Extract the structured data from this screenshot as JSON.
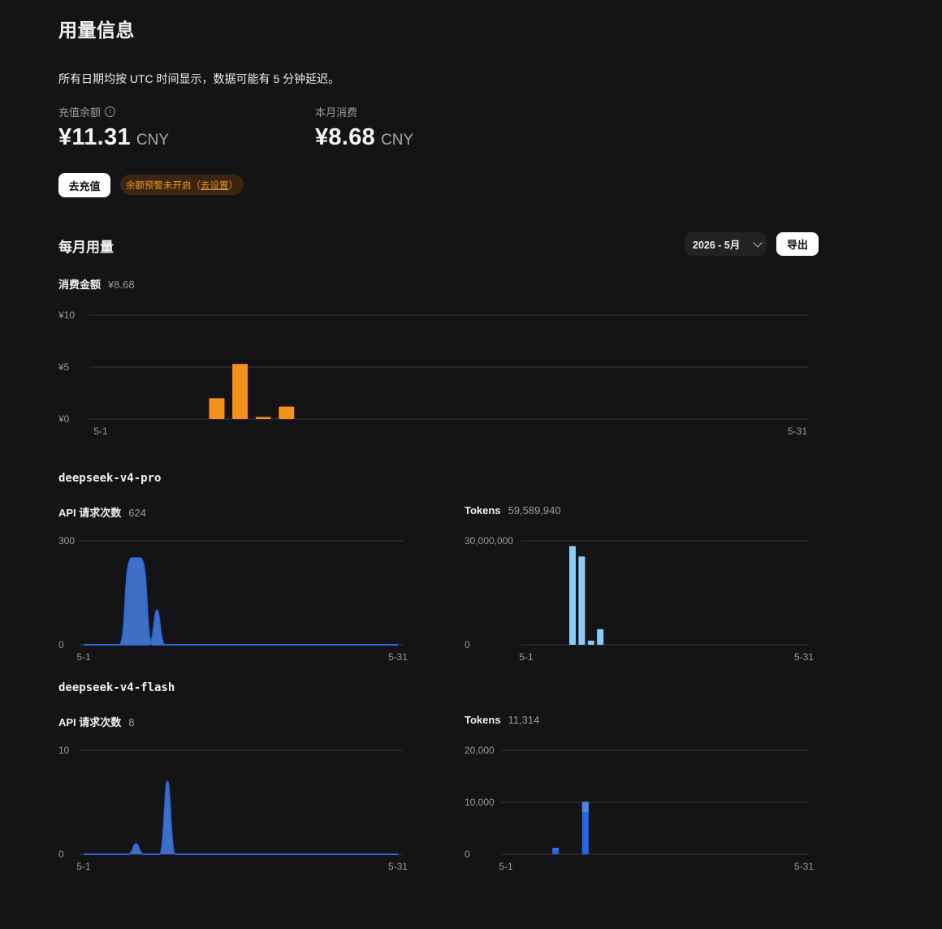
{
  "page": {
    "title": "用量信息",
    "note": "所有日期均按 UTC 时间显示，数据可能有 5 分钟延迟。"
  },
  "balance": {
    "label": "充值余额",
    "info_icon": "info-icon",
    "value": "¥11.31",
    "unit": "CNY"
  },
  "spend": {
    "label": "本月消费",
    "value": "¥8.68",
    "unit": "CNY"
  },
  "actions": {
    "recharge_label": "去充值",
    "warning_text": "余额预警未开启（",
    "warning_link": "去设置",
    "warning_close": "）"
  },
  "monthly": {
    "title": "每月用量",
    "month_select": "2026 - 5月",
    "export_label": "导出",
    "cost_label": "消费金额",
    "cost_value": "¥8.68"
  },
  "models": [
    {
      "name": "deepseek-v4-pro",
      "requests_label": "API 请求次数",
      "requests_value": "624",
      "tokens_label": "Tokens",
      "tokens_value": "59,589,940"
    },
    {
      "name": "deepseek-v4-flash",
      "requests_label": "API 请求次数",
      "requests_value": "8",
      "tokens_label": "Tokens",
      "tokens_value": "11,314"
    }
  ],
  "colors": {
    "cost": "#f5901a",
    "requests_fill": "#3d6fc4",
    "requests_line": "#2f66d9",
    "tokens_light": "#8ccaf7",
    "tokens_dark": "#2367e8",
    "grid": "#36363a"
  },
  "chart_data": [
    {
      "id": "cost",
      "type": "bar",
      "series_name": "",
      "x_start": "5-1",
      "x_end": "5-31",
      "days": 31,
      "x": [
        6,
        7,
        8,
        9
      ],
      "values": [
        2.0,
        5.3,
        0.2,
        1.2
      ],
      "ylim": [
        0,
        10
      ],
      "yticks": [
        0,
        5,
        10
      ],
      "ytick_labels": [
        "¥0",
        "¥5",
        "¥10"
      ],
      "grid": true
    },
    {
      "id": "pro-requests",
      "type": "area",
      "x_start": "5-1",
      "x_end": "5-31",
      "days": 31,
      "values": [
        0,
        0,
        0,
        0,
        0,
        250,
        0,
        0,
        0,
        0,
        0,
        0,
        0,
        0,
        0,
        0,
        0,
        0,
        0,
        0,
        0,
        0,
        0,
        0,
        0,
        0,
        0,
        0,
        0,
        0,
        0
      ],
      "values_secondary": [
        0,
        0,
        0,
        0,
        0,
        0,
        0,
        100,
        0,
        0,
        0,
        0,
        0,
        0,
        0,
        0,
        0,
        0,
        0,
        0,
        0,
        0,
        0,
        0,
        0,
        0,
        0,
        0,
        0,
        0,
        0
      ],
      "ylim": [
        0,
        300
      ],
      "yticks": [
        0,
        300
      ],
      "ytick_labels": [
        "0",
        "300"
      ],
      "grid": true
    },
    {
      "id": "pro-tokens",
      "type": "bar",
      "x_start": "5-1",
      "x_end": "5-31",
      "days": 31,
      "x": [
        6,
        7,
        8,
        9
      ],
      "values": [
        28500000,
        25500000,
        1200000,
        4500000
      ],
      "ylim": [
        0,
        30000000
      ],
      "yticks": [
        0,
        30000000
      ],
      "ytick_labels": [
        "0",
        "30,000,000"
      ],
      "grid": true
    },
    {
      "id": "flash-requests",
      "type": "area",
      "x_start": "5-1",
      "x_end": "5-31",
      "days": 31,
      "values": [
        0,
        0,
        0,
        0,
        0,
        1,
        0,
        0,
        7,
        0,
        0,
        0,
        0,
        0,
        0,
        0,
        0,
        0,
        0,
        0,
        0,
        0,
        0,
        0,
        0,
        0,
        0,
        0,
        0,
        0,
        0
      ],
      "ylim": [
        0,
        10
      ],
      "yticks": [
        0,
        10
      ],
      "ytick_labels": [
        "0",
        "10"
      ],
      "grid": true
    },
    {
      "id": "flash-tokens",
      "type": "bar",
      "x_start": "5-1",
      "x_end": "5-31",
      "days": 31,
      "x": [
        6,
        9
      ],
      "values": [
        1200,
        10100
      ],
      "values_light_cap": [
        300,
        2000
      ],
      "ylim": [
        0,
        20000
      ],
      "yticks": [
        0,
        10000,
        20000
      ],
      "ytick_labels": [
        "0",
        "10,000",
        "20,000"
      ],
      "grid": true
    }
  ]
}
